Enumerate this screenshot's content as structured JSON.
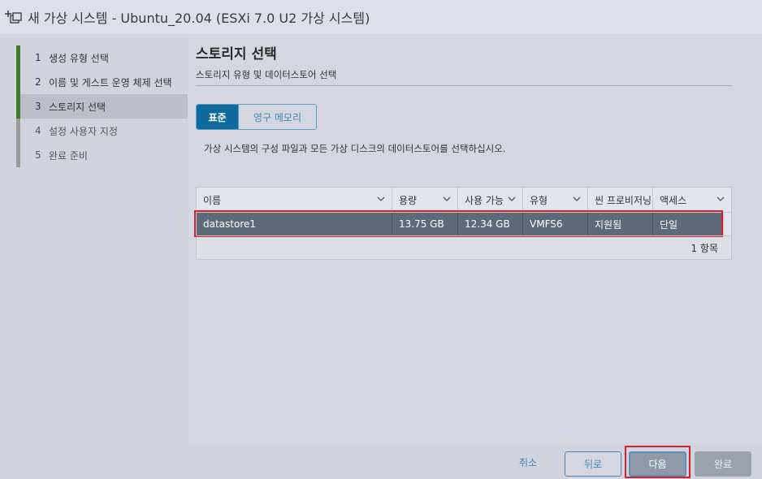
{
  "window": {
    "title": "새 가상 시스템 - Ubuntu_20.04 (ESXi 7.0 U2 가상 시스템)",
    "icon": "new-vm-icon"
  },
  "steps": [
    {
      "num": "1",
      "label": "생성 유형 선택",
      "state": "done"
    },
    {
      "num": "2",
      "label": "이름 및 게스트 운영 체제 선택",
      "state": "done"
    },
    {
      "num": "3",
      "label": "스토리지 선택",
      "state": "current"
    },
    {
      "num": "4",
      "label": "설정 사용자 지정",
      "state": "pending"
    },
    {
      "num": "5",
      "label": "완료 준비",
      "state": "pending"
    }
  ],
  "page": {
    "title": "스토리지 선택",
    "subtitle": "스토리지 유형 및 데이터스토어 선택",
    "tabs": [
      {
        "label": "표준",
        "active": true
      },
      {
        "label": "영구 메모리",
        "active": false
      }
    ],
    "description": "가상 시스템의 구성 파일과 모든 가상 디스크의 데이터스토어를 선택하십시오."
  },
  "table": {
    "columns": [
      "이름",
      "용량",
      "사용 가능",
      "유형",
      "씬 프로비저닝",
      "액세스"
    ],
    "rows": [
      [
        "datastore1",
        "13.75 GB",
        "12.34 GB",
        "VMFS6",
        "지원됨",
        "단일"
      ]
    ],
    "footer": "1 항목"
  },
  "buttons": {
    "cancel": "취소",
    "back": "뒤로",
    "next": "다음",
    "finish": "완료"
  },
  "colors": {
    "accent": "#0f6b9e",
    "step_done": "#3d7b28",
    "selected_row": "#5c6a79",
    "highlight": "#d8202a"
  }
}
